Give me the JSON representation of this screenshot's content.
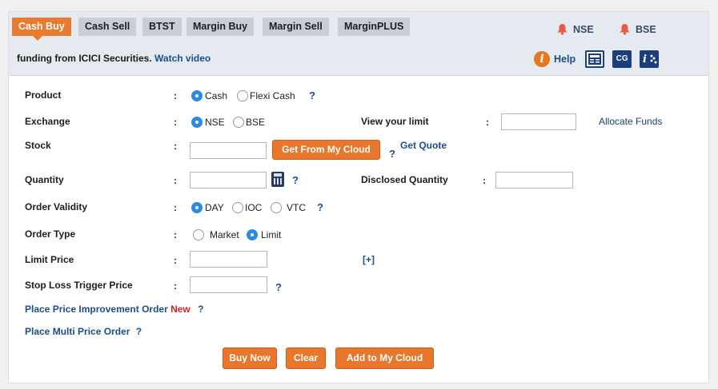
{
  "tabs": [
    {
      "label": "Cash Buy",
      "active": true
    },
    {
      "label": "Cash Sell",
      "active": false
    },
    {
      "label": "BTST",
      "active": false
    },
    {
      "label": "Margin Buy",
      "active": false
    },
    {
      "label": "Margin Sell",
      "active": false
    },
    {
      "label": "MarginPLUS",
      "active": false
    }
  ],
  "alerts": {
    "nse": "NSE",
    "bse": "BSE"
  },
  "banner": {
    "text": "funding from ICICI Securities.",
    "link": "Watch video"
  },
  "tools": {
    "help": "Help",
    "cg": "CG",
    "info_glyph": "i",
    "news_icon": "newspaper-icon",
    "chart_icon": "info-chart-icon"
  },
  "form": {
    "product": {
      "label": "Product",
      "options": [
        "Cash",
        "Flexi Cash"
      ],
      "selected": "Cash",
      "help": "?"
    },
    "exchange": {
      "label": "Exchange",
      "options": [
        "NSE",
        "BSE"
      ],
      "selected": "NSE"
    },
    "view_limit": {
      "label": "View your limit",
      "value": "",
      "allocate": "Allocate Funds"
    },
    "stock": {
      "label": "Stock",
      "value": "",
      "cloud_button": "Get From My Cloud",
      "help": "?",
      "quote": "Get Quote"
    },
    "quantity": {
      "label": "Quantity",
      "value": "",
      "help": "?"
    },
    "disclosed": {
      "label": "Disclosed Quantity",
      "value": ""
    },
    "validity": {
      "label": "Order Validity",
      "options": [
        "DAY",
        "IOC",
        "VTC"
      ],
      "selected": "DAY",
      "help": "?"
    },
    "order_type": {
      "label": "Order Type",
      "options": [
        "Market",
        "Limit"
      ],
      "selected": "Limit"
    },
    "limit_price": {
      "label": "Limit Price",
      "value": "",
      "expand": "[+]"
    },
    "stop_loss": {
      "label": "Stop Loss Trigger Price",
      "value": "",
      "help": "?"
    },
    "price_improvement": {
      "label": "Place Price Improvement Order",
      "badge": "New",
      "help": "?"
    },
    "multi_price": {
      "label": "Place Multi Price Order",
      "help": "?"
    },
    "colon": ":"
  },
  "actions": {
    "buy": "Buy Now",
    "clear": "Clear",
    "cloud": "Add to My Cloud"
  },
  "colors": {
    "accent": "#ea7a30",
    "link": "#1c4e8a",
    "radio": "#2d8ae0"
  }
}
